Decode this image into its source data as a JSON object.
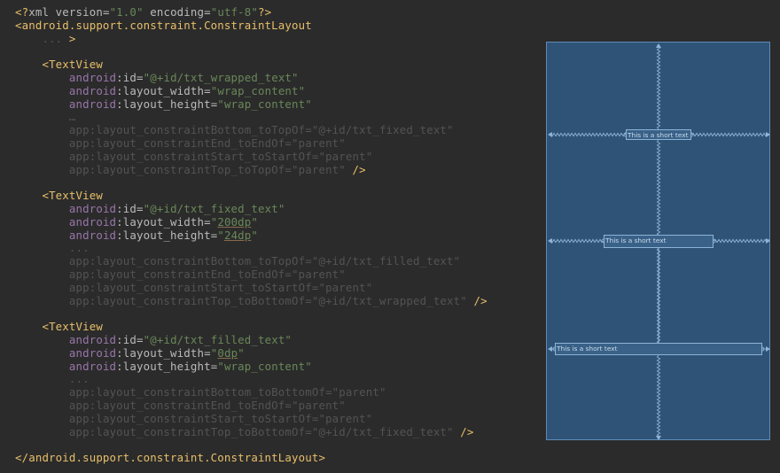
{
  "editor": {
    "lines": [
      {
        "tokens": [
          {
            "t": "<?",
            "c": "pi"
          },
          {
            "t": "xml version=",
            "c": "an"
          },
          {
            "t": "\"1.0\"",
            "c": "val"
          },
          {
            "t": " encoding=",
            "c": "an"
          },
          {
            "t": "\"utf-8\"",
            "c": "val"
          },
          {
            "t": "?>",
            "c": "pi"
          }
        ]
      },
      {
        "tokens": [
          {
            "t": "<android.support.constraint.ConstraintLayout",
            "c": "tag"
          }
        ]
      },
      {
        "tokens": [
          {
            "t": "    ",
            "c": "pl"
          },
          {
            "t": "...",
            "c": "dim"
          },
          {
            "t": " >",
            "c": "tag"
          }
        ]
      },
      {
        "tokens": []
      },
      {
        "tokens": [
          {
            "t": "    ",
            "c": "pl"
          },
          {
            "t": "<TextView",
            "c": "tag"
          }
        ]
      },
      {
        "tokens": [
          {
            "t": "        ",
            "c": "pl"
          },
          {
            "t": "android",
            "c": "ns"
          },
          {
            "t": ":id=",
            "c": "an"
          },
          {
            "t": "\"@+id/txt_wrapped_text\"",
            "c": "val"
          }
        ]
      },
      {
        "tokens": [
          {
            "t": "        ",
            "c": "pl"
          },
          {
            "t": "android",
            "c": "ns"
          },
          {
            "t": ":layout_width=",
            "c": "an"
          },
          {
            "t": "\"wrap_content\"",
            "c": "val"
          }
        ]
      },
      {
        "tokens": [
          {
            "t": "        ",
            "c": "pl"
          },
          {
            "t": "android",
            "c": "ns"
          },
          {
            "t": ":layout_height=",
            "c": "an"
          },
          {
            "t": "\"wrap_content\"",
            "c": "val"
          }
        ]
      },
      {
        "tokens": [
          {
            "t": "        ",
            "c": "pl"
          },
          {
            "t": "…",
            "c": "dim"
          }
        ]
      },
      {
        "tokens": [
          {
            "t": "        ",
            "c": "pl"
          },
          {
            "t": "app:layout_constraintBottom_toTopOf=\"@+id/txt_fixed_text\"",
            "c": "dim"
          }
        ]
      },
      {
        "tokens": [
          {
            "t": "        ",
            "c": "pl"
          },
          {
            "t": "app:layout_constraintEnd_toEndOf=\"parent\"",
            "c": "dim"
          }
        ]
      },
      {
        "tokens": [
          {
            "t": "        ",
            "c": "pl"
          },
          {
            "t": "app:layout_constraintStart_toStartOf=\"parent\"",
            "c": "dim"
          }
        ]
      },
      {
        "tokens": [
          {
            "t": "        ",
            "c": "pl"
          },
          {
            "t": "app:layout_constraintTop_toTopOf=\"parent\"",
            "c": "dim"
          },
          {
            "t": " />",
            "c": "tag"
          }
        ]
      },
      {
        "tokens": []
      },
      {
        "tokens": [
          {
            "t": "    ",
            "c": "pl"
          },
          {
            "t": "<TextView",
            "c": "tag"
          }
        ]
      },
      {
        "tokens": [
          {
            "t": "        ",
            "c": "pl"
          },
          {
            "t": "android",
            "c": "ns"
          },
          {
            "t": ":id=",
            "c": "an"
          },
          {
            "t": "\"@+id/txt_fixed_text\"",
            "c": "val"
          }
        ]
      },
      {
        "tokens": [
          {
            "t": "        ",
            "c": "pl"
          },
          {
            "t": "android",
            "c": "ns"
          },
          {
            "t": ":layout_width=",
            "c": "an"
          },
          {
            "t": "\"",
            "c": "val"
          },
          {
            "t": "200dp",
            "c": "val under"
          },
          {
            "t": "\"",
            "c": "val"
          }
        ]
      },
      {
        "tokens": [
          {
            "t": "        ",
            "c": "pl"
          },
          {
            "t": "android",
            "c": "ns"
          },
          {
            "t": ":layout_height=",
            "c": "an"
          },
          {
            "t": "\"",
            "c": "val"
          },
          {
            "t": "24dp",
            "c": "val under"
          },
          {
            "t": "\"",
            "c": "val"
          }
        ]
      },
      {
        "tokens": [
          {
            "t": "        ",
            "c": "pl"
          },
          {
            "t": "...",
            "c": "dim"
          }
        ]
      },
      {
        "tokens": [
          {
            "t": "        ",
            "c": "pl"
          },
          {
            "t": "app:layout_constraintBottom_toTopOf=\"@+id/txt_filled_text\"",
            "c": "dim"
          }
        ]
      },
      {
        "tokens": [
          {
            "t": "        ",
            "c": "pl"
          },
          {
            "t": "app:layout_constraintEnd_toEndOf=\"parent\"",
            "c": "dim"
          }
        ]
      },
      {
        "tokens": [
          {
            "t": "        ",
            "c": "pl"
          },
          {
            "t": "app:layout_constraintStart_toStartOf=\"parent\"",
            "c": "dim"
          }
        ]
      },
      {
        "tokens": [
          {
            "t": "        ",
            "c": "pl"
          },
          {
            "t": "app:layout_constraintTop_toBottomOf=\"@+id/txt_wrapped_text\"",
            "c": "dim"
          },
          {
            "t": " />",
            "c": "tag"
          }
        ]
      },
      {
        "tokens": []
      },
      {
        "tokens": [
          {
            "t": "    ",
            "c": "pl"
          },
          {
            "t": "<TextView",
            "c": "tag"
          }
        ]
      },
      {
        "tokens": [
          {
            "t": "        ",
            "c": "pl"
          },
          {
            "t": "android",
            "c": "ns"
          },
          {
            "t": ":id=",
            "c": "an"
          },
          {
            "t": "\"@+id/txt_filled_text\"",
            "c": "val"
          }
        ]
      },
      {
        "tokens": [
          {
            "t": "        ",
            "c": "pl"
          },
          {
            "t": "android",
            "c": "ns"
          },
          {
            "t": ":layout_width=",
            "c": "an"
          },
          {
            "t": "\"",
            "c": "val"
          },
          {
            "t": "0dp",
            "c": "val under"
          },
          {
            "t": "\"",
            "c": "val"
          }
        ]
      },
      {
        "tokens": [
          {
            "t": "        ",
            "c": "pl"
          },
          {
            "t": "android",
            "c": "ns"
          },
          {
            "t": ":layout_height=",
            "c": "an"
          },
          {
            "t": "\"wrap_content\"",
            "c": "val"
          }
        ]
      },
      {
        "tokens": [
          {
            "t": "        ",
            "c": "pl"
          },
          {
            "t": "...",
            "c": "dim"
          }
        ]
      },
      {
        "tokens": [
          {
            "t": "        ",
            "c": "pl"
          },
          {
            "t": "app:layout_constraintBottom_toBottomOf=\"parent\"",
            "c": "dim"
          }
        ]
      },
      {
        "tokens": [
          {
            "t": "        ",
            "c": "pl"
          },
          {
            "t": "app:layout_constraintEnd_toEndOf=\"parent\"",
            "c": "dim"
          }
        ]
      },
      {
        "tokens": [
          {
            "t": "        ",
            "c": "pl"
          },
          {
            "t": "app:layout_constraintStart_toStartOf=\"parent\"",
            "c": "dim"
          }
        ]
      },
      {
        "tokens": [
          {
            "t": "        ",
            "c": "pl"
          },
          {
            "t": "app:layout_constraintTop_toBottomOf=\"@+id/txt_fixed_text\"",
            "c": "dim"
          },
          {
            "t": " />",
            "c": "tag"
          }
        ]
      },
      {
        "tokens": []
      },
      {
        "tokens": [
          {
            "t": "</android.support.constraint.ConstraintLayout>",
            "c": "tag"
          }
        ]
      }
    ]
  },
  "preview": {
    "wrapped_text": "This is a short text",
    "fixed_text": "This is a short text",
    "filled_text": "This is a short text"
  },
  "colors": {
    "editor_bg": "#2b2b2b",
    "blueprint_bg": "#2f5377",
    "constraint_line": "#8db3d6"
  }
}
